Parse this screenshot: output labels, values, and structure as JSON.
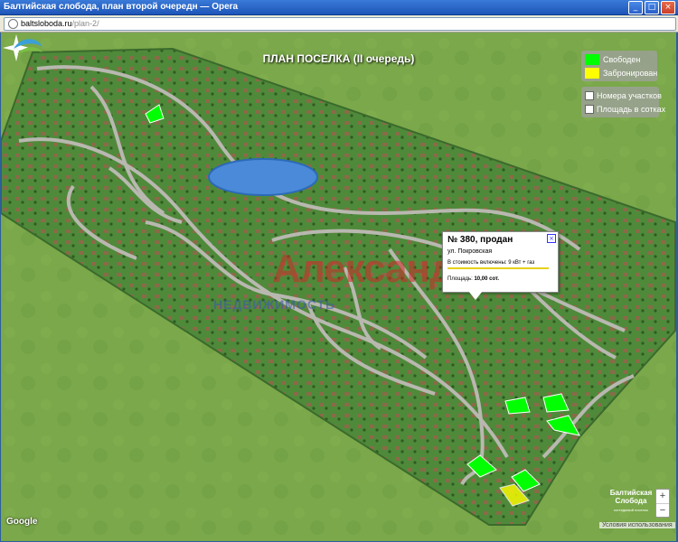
{
  "window": {
    "title": "Балтийская слобода, план второй очередн — Opera",
    "minimize_glyph": "_",
    "maximize_glyph": "□",
    "close_glyph": "×"
  },
  "address_bar": {
    "domain": "baltsloboda.ru",
    "path": "/plan-2/",
    "icon": "globe-icon"
  },
  "map": {
    "title": "ПЛАН ПОСЕЛКА (II очередь)",
    "legend": [
      {
        "label": "Свободен",
        "color": "#00ff00"
      },
      {
        "label": "Забронирован",
        "color": "#ffff00"
      }
    ],
    "toggles": [
      {
        "label": "Номера участков",
        "checked": false
      },
      {
        "label": "Площадь в сотках",
        "checked": false
      }
    ],
    "watermark": {
      "main": "Александр",
      "sub": "НЕДВИЖИМОСТЬ"
    },
    "popup": {
      "title": "№ 380, продан",
      "close_glyph": "×",
      "street": "ул. Покровская",
      "included": "В стоимость включены: 9 кВт + газ",
      "area_label": "Площадь:",
      "area_value": "10,00 сот."
    },
    "brand": {
      "name_line1": "Балтийская",
      "name_line2": "Слобода",
      "tagline": "коттеджный поселок"
    },
    "zoom": {
      "in": "+",
      "out": "−"
    },
    "google_logo": "Google",
    "terms": "Условия использования",
    "colors": {
      "field": "#7aa84a",
      "site_plan": "#4f8a3a",
      "road": "#b8b8b0",
      "lake": "#4a8ad8",
      "free": "#00ff00",
      "reserved": "#ffff00"
    }
  }
}
